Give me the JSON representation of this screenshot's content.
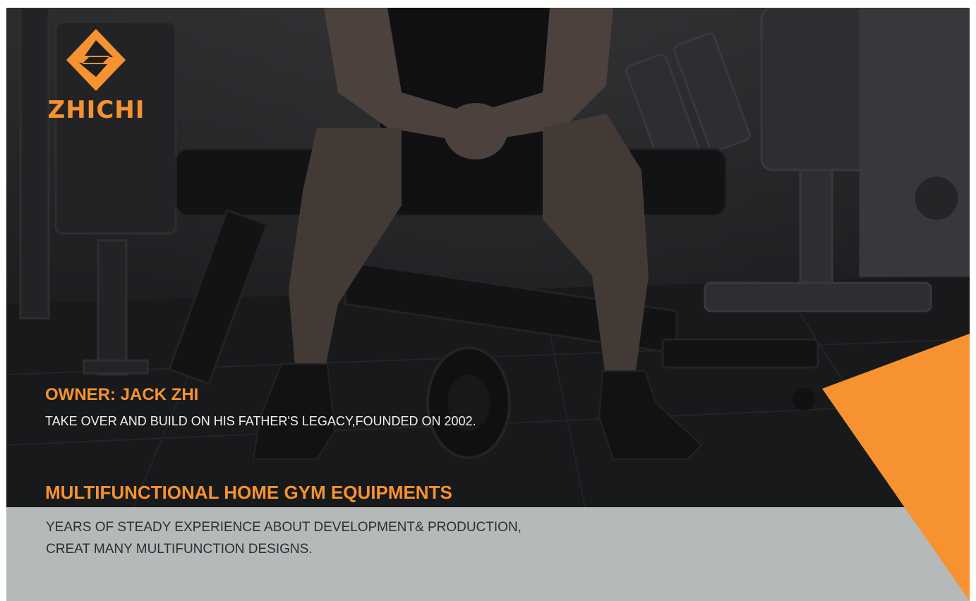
{
  "brand": {
    "name": "ZHICHI",
    "accent_color": "#f6922f",
    "logo_icon": "diamond-s-logo-icon"
  },
  "owner": {
    "title": "OWNER: JACK ZHI",
    "description": "TAKE OVER AND BUILD ON HIS FATHER'S LEGACY,FOUNDED ON 2002."
  },
  "headline": "MULTIFUNCTIONAL HOME GYM EQUIPMENTS",
  "description_lines": [
    "YEARS OF STEADY EXPERIENCE ABOUT DEVELOPMENT& PRODUCTION,",
    "CREAT MANY MULTIFUNCTION DESIGNS."
  ],
  "colors": {
    "band": "#b5b9ba",
    "photo_dark": "#1e1f21",
    "text_light": "#f1f1f1",
    "text_dark": "#2e2f31"
  }
}
